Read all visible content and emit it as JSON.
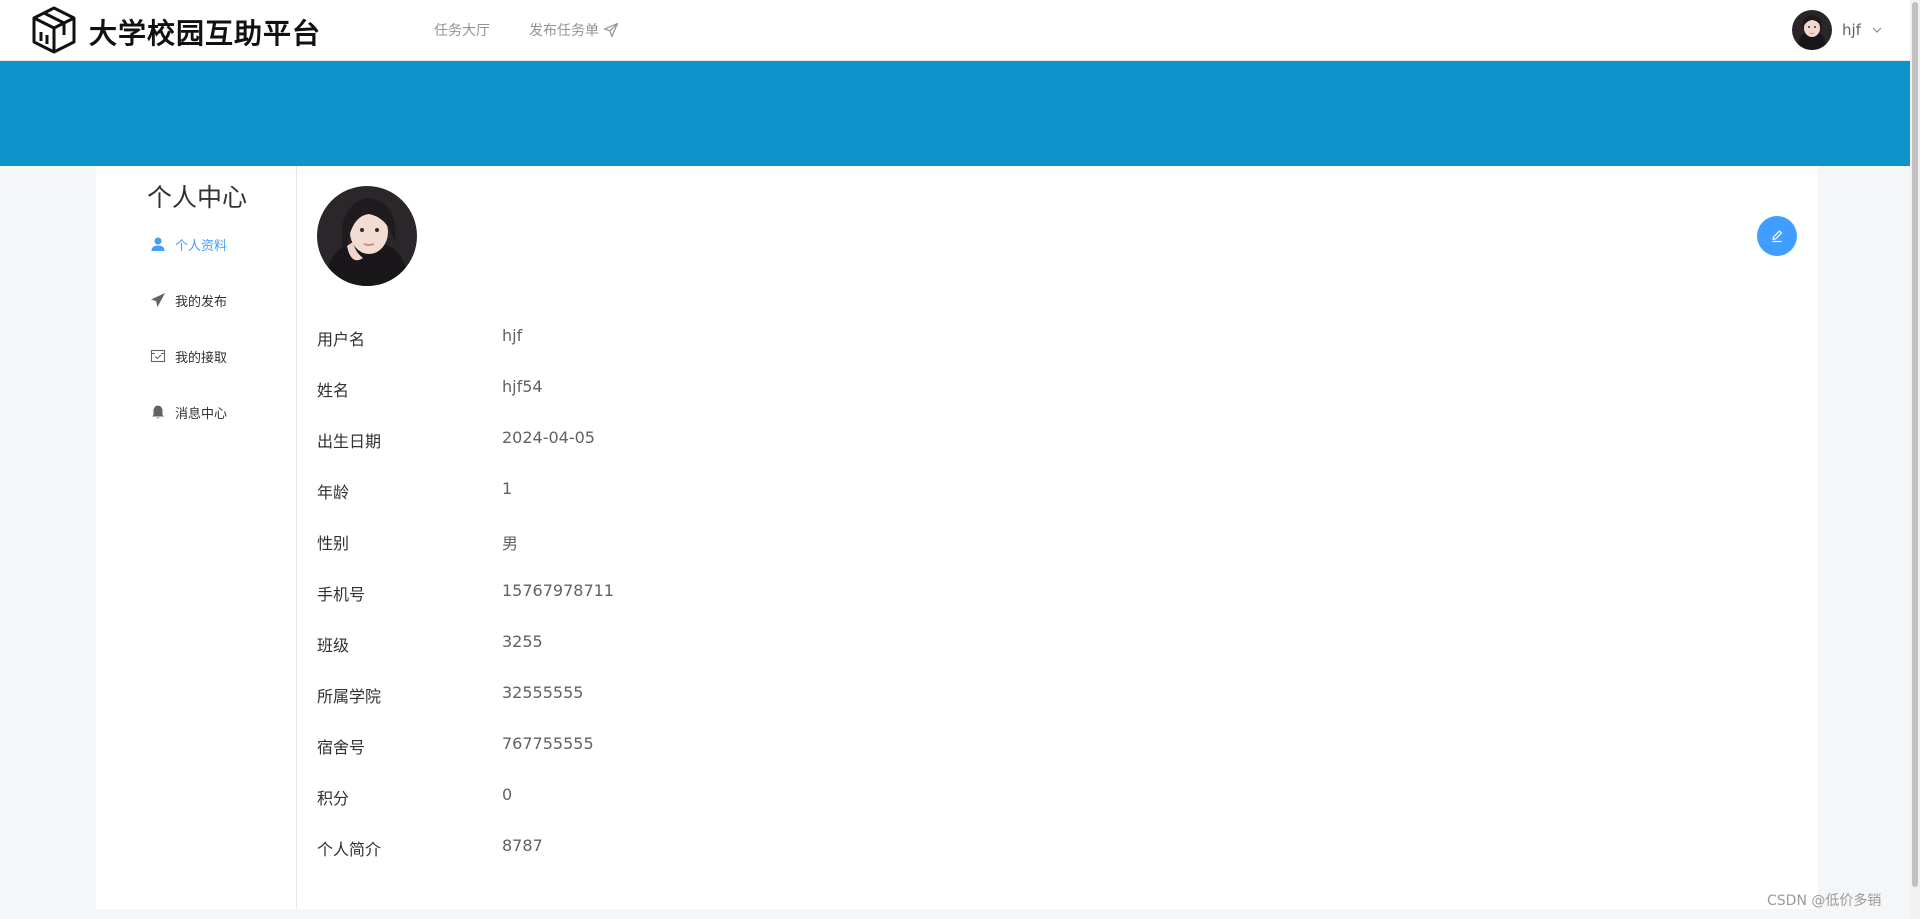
{
  "header": {
    "brand": "大学校园互助平台",
    "nav": [
      {
        "label": "任务大厅"
      },
      {
        "label": "发布任务单"
      }
    ],
    "user": {
      "name": "hjf"
    }
  },
  "sidebar": {
    "title": "个人中心",
    "items": [
      {
        "label": "个人资料",
        "icon": "user-icon",
        "active": true
      },
      {
        "label": "我的发布",
        "icon": "paper-plane-icon",
        "active": false
      },
      {
        "label": "我的接取",
        "icon": "inbox-check-icon",
        "active": false
      },
      {
        "label": "消息中心",
        "icon": "bell-icon",
        "active": false
      }
    ]
  },
  "profile": {
    "fields": [
      {
        "label": "用户名",
        "value": "hjf"
      },
      {
        "label": "姓名",
        "value": "hjf54"
      },
      {
        "label": "出生日期",
        "value": "2024-04-05"
      },
      {
        "label": "年龄",
        "value": "1"
      },
      {
        "label": "性别",
        "value": "男"
      },
      {
        "label": "手机号",
        "value": "15767978711"
      },
      {
        "label": "班级",
        "value": "3255"
      },
      {
        "label": "所属学院",
        "value": "32555555"
      },
      {
        "label": "宿舍号",
        "value": "767755555"
      },
      {
        "label": "积分",
        "value": "0"
      },
      {
        "label": "个人简介",
        "value": "8787"
      }
    ]
  },
  "watermark": "CSDN @低价多销",
  "colors": {
    "banner": "#0e93cb",
    "accent": "#409eff",
    "page_bg": "#f5f6f8"
  }
}
